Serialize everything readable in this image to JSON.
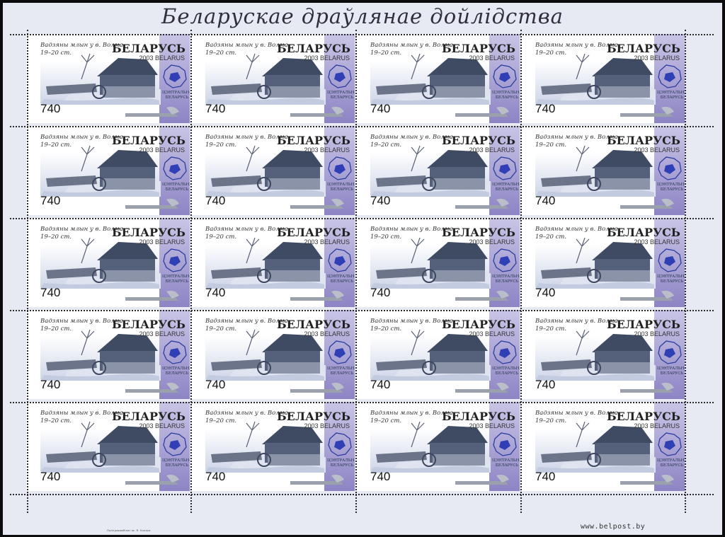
{
  "sheet": {
    "title": "Беларускае драўлянае дойлідства",
    "website": "www.belpost.by",
    "printer_imprint": "Палігракамбінат ім. Я. Коласа"
  },
  "stamp": {
    "country": "БЕЛАРУСЬ",
    "year_line": "2003 BELARUS",
    "caption": "Вадзяны млын у в. Волма. 19–20 ст.",
    "denomination": "740",
    "region": "ЦЭНТРАЛЬНАЯ БЕЛАРУСЬ",
    "picture": "water-mill-illustration",
    "region_icon": "belarus-map-icon",
    "emblem": "silver-ornament-icon"
  },
  "grid": {
    "rows": 5,
    "columns": 4,
    "count": 20
  },
  "colors": {
    "sheet": "#e7eaf2",
    "stamp_band": "#8f86c4",
    "border": "#0c0c0c"
  }
}
